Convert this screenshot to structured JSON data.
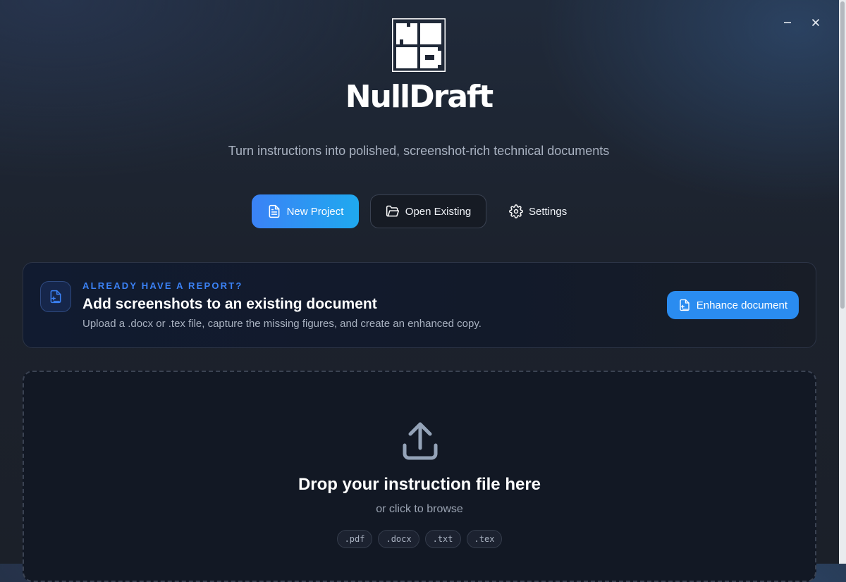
{
  "app": {
    "brand": "NullDraft",
    "tagline": "Turn instructions into polished, screenshot-rich technical documents"
  },
  "window_controls": {
    "minimize_icon": "minus-icon",
    "close_icon": "close-icon"
  },
  "actions": {
    "new_project": {
      "label": "New Project",
      "icon": "file-text-icon"
    },
    "open_existing": {
      "label": "Open Existing",
      "icon": "folder-open-icon"
    },
    "settings": {
      "label": "Settings",
      "icon": "gear-icon"
    }
  },
  "banner": {
    "eyebrow": "ALREADY HAVE A REPORT?",
    "title": "Add screenshots to an existing document",
    "description": "Upload a .docx or .tex file, capture the missing figures, and create an enhanced copy.",
    "button_label": "Enhance document",
    "icon": "file-plus-icon"
  },
  "dropzone": {
    "title": "Drop your instruction file here",
    "subtitle": "or click to browse",
    "icon": "upload-icon",
    "formats": [
      ".pdf",
      ".docx",
      ".txt",
      ".tex"
    ]
  },
  "colors": {
    "accent": "#3b82f6",
    "accent_gradient_end": "#1fa9ef",
    "enhance_button": "#2a8cf0",
    "background": "#1c222d"
  }
}
